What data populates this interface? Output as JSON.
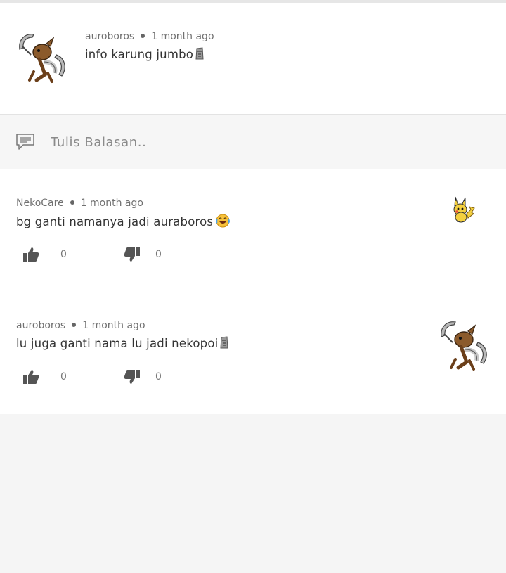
{
  "main_comment": {
    "author": "auroboros",
    "time": "1 month ago",
    "text": "info karung jumbo",
    "avatar_icon": "kabutops-sprite-icon",
    "emoji_icon": "moai-icon"
  },
  "reply_bar": {
    "placeholder": "Tulis Balasan..",
    "icon": "comment-bubble-icon"
  },
  "replies": [
    {
      "author": "NekoCare",
      "time": "1 month ago",
      "text": "bg ganti namanya jadi auraboros",
      "emoji_icon": "face-with-tears-of-joy-icon",
      "avatar_icon": "pikachu-sprite-icon",
      "likes": "0",
      "dislikes": "0"
    },
    {
      "author": "auroboros",
      "time": "1 month ago",
      "text": "lu juga ganti nama lu jadi nekopoi",
      "emoji_icon": "moai-icon",
      "avatar_icon": "kabutops-sprite-icon",
      "likes": "0",
      "dislikes": "0"
    }
  ],
  "colors": {
    "page_bg": "#f5f5f5",
    "card_bg": "#ffffff",
    "vote_icon": "#555555"
  }
}
